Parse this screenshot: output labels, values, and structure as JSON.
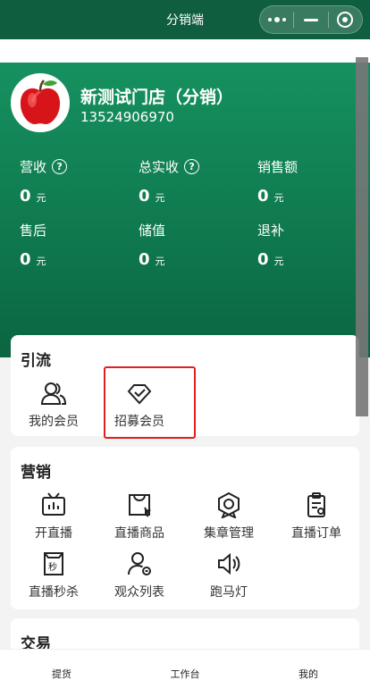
{
  "window": {
    "title": "分销端"
  },
  "store": {
    "name": "新测试门店（分销）",
    "phone": "13524906970"
  },
  "stats": [
    {
      "label": "营收",
      "value": "0",
      "unit": "元",
      "has_help": true
    },
    {
      "label": "总实收",
      "value": "0",
      "unit": "元",
      "has_help": true
    },
    {
      "label": "销售额",
      "value": "0",
      "unit": "元",
      "has_help": false
    },
    {
      "label": "售后",
      "value": "0",
      "unit": "元",
      "has_help": false
    },
    {
      "label": "储值",
      "value": "0",
      "unit": "元",
      "has_help": false
    },
    {
      "label": "退补",
      "value": "0",
      "unit": "元",
      "has_help": false
    }
  ],
  "help_glyph": "?",
  "sections": {
    "traffic": {
      "title": "引流",
      "items": [
        {
          "label": "我的会员",
          "icon": "members-icon"
        },
        {
          "label": "招募会员",
          "icon": "recruit-diamond-icon"
        }
      ]
    },
    "marketing": {
      "title": "营销",
      "items": [
        {
          "label": "开直播",
          "icon": "tv-icon"
        },
        {
          "label": "直播商品",
          "icon": "shopping-bag-icon"
        },
        {
          "label": "集章管理",
          "icon": "badge-icon"
        },
        {
          "label": "直播订单",
          "icon": "clipboard-icon"
        },
        {
          "label": "直播秒杀",
          "icon": "flash-sale-icon"
        },
        {
          "label": "观众列表",
          "icon": "audience-icon"
        },
        {
          "label": "跑马灯",
          "icon": "speaker-icon"
        }
      ]
    },
    "trade": {
      "title": "交易"
    }
  },
  "tabs": [
    {
      "label": "提货"
    },
    {
      "label": "工作台"
    },
    {
      "label": "我的"
    }
  ],
  "colors": {
    "header": "#0e5e3f",
    "hero_top": "#16915f",
    "hero_bottom": "#0b6541",
    "highlight": "#e02020"
  }
}
